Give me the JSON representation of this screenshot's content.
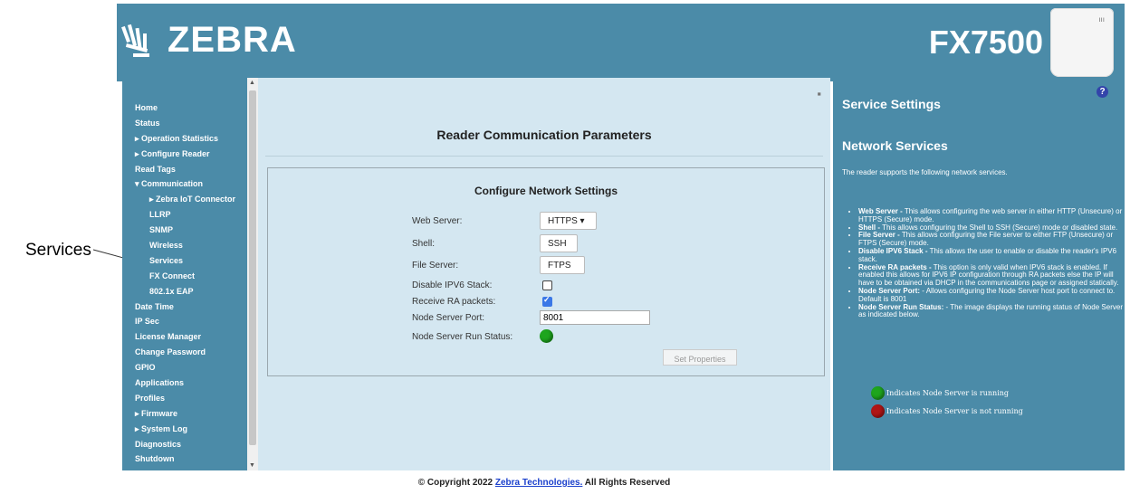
{
  "callout": {
    "label": "Services"
  },
  "header": {
    "brand": "ZEBRA",
    "model": "FX7500"
  },
  "sidebar": {
    "items": [
      {
        "label": "Home",
        "indent": 0
      },
      {
        "label": "Status",
        "indent": 0
      },
      {
        "label": "▸ Operation Statistics",
        "indent": 0
      },
      {
        "label": "▸ Configure Reader",
        "indent": 0
      },
      {
        "label": "Read Tags",
        "indent": 0
      },
      {
        "label": "▾ Communication",
        "indent": 0
      },
      {
        "label": "▸ Zebra IoT Connector",
        "indent": 1
      },
      {
        "label": "LLRP",
        "indent": 1
      },
      {
        "label": "SNMP",
        "indent": 1
      },
      {
        "label": "Wireless",
        "indent": 1
      },
      {
        "label": "Services",
        "indent": 1
      },
      {
        "label": "FX Connect",
        "indent": 1
      },
      {
        "label": "802.1x EAP",
        "indent": 1
      },
      {
        "label": "Date Time",
        "indent": 0
      },
      {
        "label": "IP Sec",
        "indent": 0
      },
      {
        "label": "License Manager",
        "indent": 0
      },
      {
        "label": "Change Password",
        "indent": 0
      },
      {
        "label": "GPIO",
        "indent": 0
      },
      {
        "label": "Applications",
        "indent": 0
      },
      {
        "label": "Profiles",
        "indent": 0
      },
      {
        "label": "▸ Firmware",
        "indent": 0
      },
      {
        "label": "▸ System Log",
        "indent": 0
      },
      {
        "label": "Diagnostics",
        "indent": 0
      },
      {
        "label": "Shutdown",
        "indent": 0
      }
    ]
  },
  "main": {
    "title": "Reader Communication Parameters",
    "panel_title": "Configure Network Settings",
    "web_server": {
      "label": "Web Server:",
      "value": "HTTPS ▾"
    },
    "shell": {
      "label": "Shell:",
      "value": "SSH ▾"
    },
    "file_server": {
      "label": "File Server:",
      "value": "FTPS ▾"
    },
    "disable_ipv6": {
      "label": "Disable IPV6 Stack:",
      "checked": false
    },
    "receive_ra": {
      "label": "Receive RA packets:",
      "checked": true
    },
    "node_port": {
      "label": "Node Server Port:",
      "value": "8001"
    },
    "node_status": {
      "label": "Node Server Run Status:",
      "running": true
    },
    "set_button": "Set Properties"
  },
  "footer": {
    "prefix": "© Copyright 2022 ",
    "link": "Zebra Technologies.",
    "suffix": " All Rights Reserved"
  },
  "help": {
    "title": "Service Settings",
    "subtitle": "Network Services",
    "intro": "The reader supports the following network services.",
    "items": [
      {
        "term": "Web Server -",
        "text": " This allows configuring the web server in either HTTP (Unsecure) or HTTPS (Secure) mode."
      },
      {
        "term": "Shell -",
        "text": " This allows configuring the Shell to SSH (Secure) mode or disabled state."
      },
      {
        "term": "File Server -",
        "text": " This allows configuring the File server to either FTP (Unsecure) or FTPS (Secure) mode."
      },
      {
        "term": "Disable IPV6 Stack -",
        "text": " This allows the user to enable or disable the reader's IPV6 stack."
      },
      {
        "term": "Receive RA packets -",
        "text": " This option is only valid when IPV6 stack is enabled. If enabled this allows for IPV6 IP configuration through RA packets else the IP will have to be obtained via DHCP in the communications page or assigned statically."
      },
      {
        "term": "Node Server Port:",
        "text": " - Allows configuring the Node Server host port to connect to. Default is 8001"
      },
      {
        "term": "Node Server Run Status:",
        "text": " - The image displays the running status of Node Server as indicated below."
      }
    ],
    "legend_running": "Indicates Node Server is running",
    "legend_not_running": "Indicates Node Server is not running"
  },
  "colors": {
    "brand_bg": "#4b8ba8",
    "main_bg": "#d4e7f1",
    "running": "#1ea51e",
    "stopped": "#b01515"
  }
}
